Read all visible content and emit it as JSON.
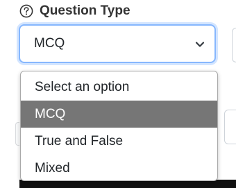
{
  "field": {
    "label": "Question Type",
    "help_icon": "question-circle-icon",
    "selected_value": "MCQ",
    "chevron_icon": "chevron-down-icon"
  },
  "dropdown": {
    "options": [
      {
        "label": "Select an option",
        "selected": false
      },
      {
        "label": "MCQ",
        "selected": true
      },
      {
        "label": "True and False",
        "selected": false
      },
      {
        "label": "Mixed",
        "selected": false
      }
    ]
  },
  "colors": {
    "focus_border": "#86b7fe",
    "selected_option_bg": "#767676",
    "selected_option_text": "#ffffff"
  }
}
